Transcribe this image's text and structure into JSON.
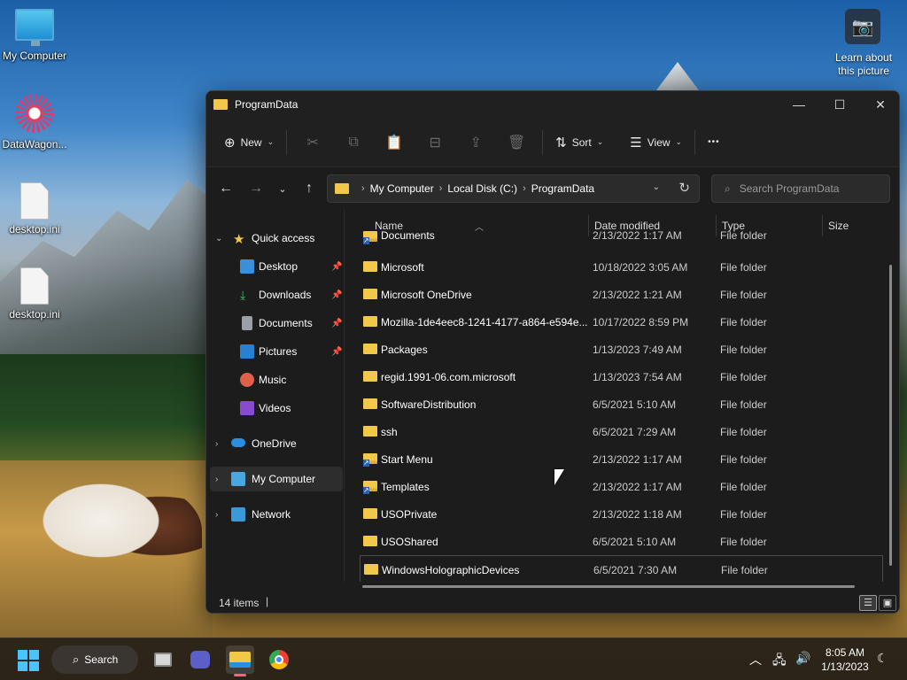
{
  "desktop": {
    "icons": [
      {
        "label": "My Computer"
      },
      {
        "label": "DataWagon..."
      },
      {
        "label": "desktop.ini"
      },
      {
        "label": "desktop.ini"
      }
    ],
    "learn_label": "Learn about this picture"
  },
  "window": {
    "title": "ProgramData",
    "controls": {
      "minimize": "—",
      "maximize": "☐",
      "close": "✕"
    }
  },
  "commandbar": {
    "new_label": "New",
    "sort_label": "Sort",
    "view_label": "View",
    "more_label": "•••"
  },
  "address": {
    "crumbs": [
      "My Computer",
      "Local Disk (C:)",
      "ProgramData"
    ],
    "search_placeholder": "Search ProgramData"
  },
  "navpane": {
    "quick_access": "Quick access",
    "items": [
      {
        "label": "Desktop",
        "pinned": true
      },
      {
        "label": "Downloads",
        "pinned": true
      },
      {
        "label": "Documents",
        "pinned": true
      },
      {
        "label": "Pictures",
        "pinned": true
      },
      {
        "label": "Music",
        "pinned": false
      },
      {
        "label": "Videos",
        "pinned": false
      }
    ],
    "onedrive": "OneDrive",
    "mycomputer": "My Computer",
    "network": "Network"
  },
  "columns": {
    "name": "Name",
    "date": "Date modified",
    "type": "Type",
    "size": "Size"
  },
  "files": [
    {
      "name": "Documents",
      "date": "2/13/2022 1:17 AM",
      "type": "File folder",
      "shortcut": true
    },
    {
      "name": "Microsoft",
      "date": "10/18/2022 3:05 AM",
      "type": "File folder",
      "shortcut": false
    },
    {
      "name": "Microsoft OneDrive",
      "date": "2/13/2022 1:21 AM",
      "type": "File folder",
      "shortcut": false
    },
    {
      "name": "Mozilla-1de4eec8-1241-4177-a864-e594e...",
      "date": "10/17/2022 8:59 PM",
      "type": "File folder",
      "shortcut": false
    },
    {
      "name": "Packages",
      "date": "1/13/2023 7:49 AM",
      "type": "File folder",
      "shortcut": false
    },
    {
      "name": "regid.1991-06.com.microsoft",
      "date": "1/13/2023 7:54 AM",
      "type": "File folder",
      "shortcut": false
    },
    {
      "name": "SoftwareDistribution",
      "date": "6/5/2021 5:10 AM",
      "type": "File folder",
      "shortcut": false
    },
    {
      "name": "ssh",
      "date": "6/5/2021 7:29 AM",
      "type": "File folder",
      "shortcut": false
    },
    {
      "name": "Start Menu",
      "date": "2/13/2022 1:17 AM",
      "type": "File folder",
      "shortcut": true
    },
    {
      "name": "Templates",
      "date": "2/13/2022 1:17 AM",
      "type": "File folder",
      "shortcut": true
    },
    {
      "name": "USOPrivate",
      "date": "2/13/2022 1:18 AM",
      "type": "File folder",
      "shortcut": false
    },
    {
      "name": "USOShared",
      "date": "6/5/2021 5:10 AM",
      "type": "File folder",
      "shortcut": false
    },
    {
      "name": "WindowsHolographicDevices",
      "date": "6/5/2021 7:30 AM",
      "type": "File folder",
      "shortcut": false
    }
  ],
  "status": {
    "items": "14 items"
  },
  "taskbar": {
    "search_label": "Search",
    "time": "8:05 AM",
    "date": "1/13/2023"
  }
}
